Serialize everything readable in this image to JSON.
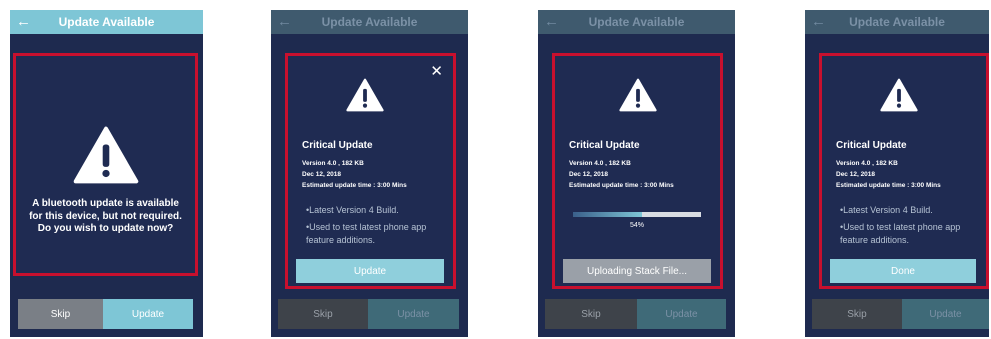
{
  "screens": [
    {
      "back_icon": "arrow-left-icon",
      "title": "Update Available",
      "message": "A bluetooth update is available for this device, but not required. Do you wish to update now?",
      "skip_label": "Skip",
      "update_label": "Update"
    },
    {
      "back_icon": "arrow-left-icon",
      "title": "Update Available",
      "close_icon": "close-icon",
      "critical_title": "Critical Update",
      "version": "Version 4.0 , 182 KB",
      "date": "Dec 12, 2018",
      "estimated_time": "Estimated update time : 3:00 Mins",
      "notes": [
        "•Latest Version 4 Build.",
        "•Used to test latest phone app feature additions."
      ],
      "card_button_label": "Update",
      "skip_label": "Skip",
      "update_label": "Update"
    },
    {
      "back_icon": "arrow-left-icon",
      "title": "Update Available",
      "critical_title": "Critical Update",
      "version": "Version 4.0 , 182 KB",
      "date": "Dec 12, 2018",
      "estimated_time": "Estimated update time : 3:00 Mins",
      "progress_percent": 54,
      "progress_label": "54%",
      "card_button_label": "Uploading Stack File...",
      "skip_label": "Skip",
      "update_label": "Update"
    },
    {
      "back_icon": "arrow-left-icon",
      "title": "Update Available",
      "critical_title": "Critical Update",
      "version": "Version 4.0 , 182 KB",
      "date": "Dec 12, 2018",
      "estimated_time": "Estimated update time : 3:00 Mins",
      "notes": [
        "•Latest Version 4 Build.",
        "•Used to test latest phone app feature additions."
      ],
      "card_button_label": "Done",
      "skip_label": "Skip",
      "update_label": "Update"
    }
  ],
  "colors": {
    "accent": "#7ec6d6",
    "background": "#1e2a4f",
    "highlight_border": "#c8102e",
    "skip_button": "#7a7f86",
    "uploading_button": "#9aa0a8"
  }
}
